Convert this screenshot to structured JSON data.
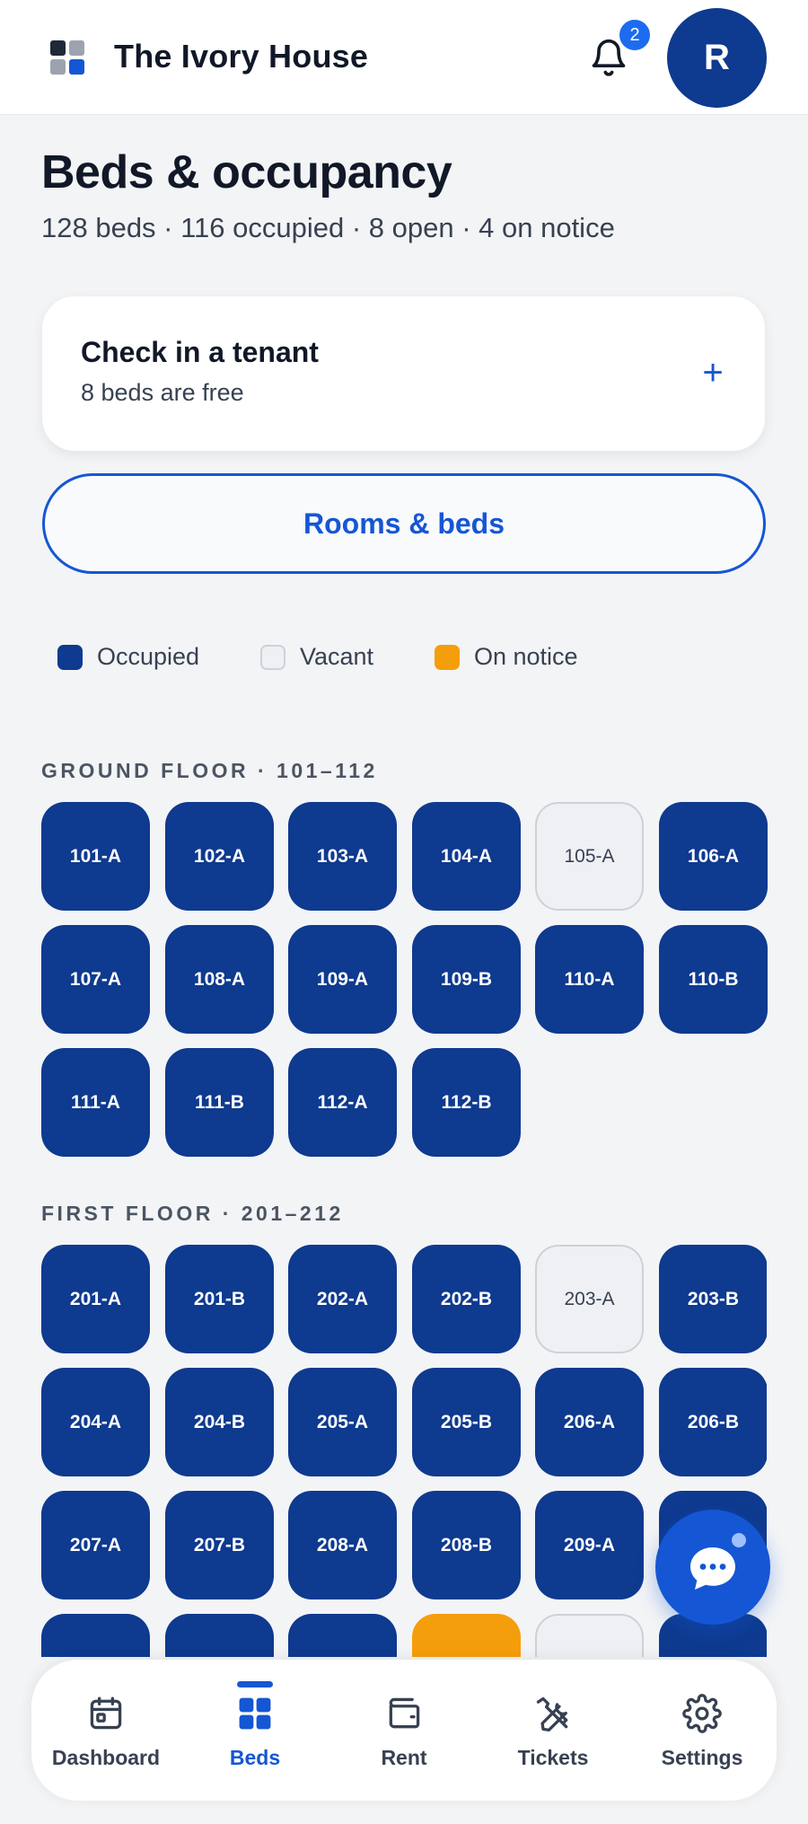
{
  "header": {
    "app_title": "The Ivory House",
    "notification_count": "2",
    "avatar_initial": "R",
    "logo_colors": [
      "#1f2937",
      "#9ca3af",
      "#9ca3af",
      "#1556d4"
    ]
  },
  "page": {
    "title": "Beds & occupancy",
    "subtitle": "128 beds · 116 occupied · 8 open · 4 on notice"
  },
  "checkin_card": {
    "title": "Check in a tenant",
    "subtitle": "8 beds are free",
    "action_icon": "plus-icon",
    "action_glyph": "+"
  },
  "rooms_button": {
    "label": "Rooms & beds"
  },
  "legend": [
    {
      "label": "Occupied",
      "status": "occupied",
      "color": "#0e3a8f"
    },
    {
      "label": "Vacant",
      "status": "vacant",
      "color": "#eef0f4"
    },
    {
      "label": "On notice",
      "status": "notice",
      "color": "#f59e0b"
    }
  ],
  "floors": [
    {
      "label": "GROUND FLOOR · 101–112",
      "beds": [
        {
          "id": "101-A",
          "status": "occupied"
        },
        {
          "id": "102-A",
          "status": "occupied"
        },
        {
          "id": "103-A",
          "status": "occupied"
        },
        {
          "id": "104-A",
          "status": "occupied"
        },
        {
          "id": "105-A",
          "status": "vacant"
        },
        {
          "id": "106-A",
          "status": "occupied"
        },
        {
          "id": "107-A",
          "status": "occupied"
        },
        {
          "id": "108-A",
          "status": "occupied"
        },
        {
          "id": "109-A",
          "status": "occupied"
        },
        {
          "id": "109-B",
          "status": "occupied"
        },
        {
          "id": "110-A",
          "status": "occupied"
        },
        {
          "id": "110-B",
          "status": "occupied"
        },
        {
          "id": "111-A",
          "status": "occupied"
        },
        {
          "id": "111-B",
          "status": "occupied"
        },
        {
          "id": "112-A",
          "status": "occupied"
        },
        {
          "id": "112-B",
          "status": "occupied"
        }
      ]
    },
    {
      "label": "FIRST FLOOR · 201–212",
      "beds": [
        {
          "id": "201-A",
          "status": "occupied"
        },
        {
          "id": "201-B",
          "status": "occupied"
        },
        {
          "id": "202-A",
          "status": "occupied"
        },
        {
          "id": "202-B",
          "status": "occupied"
        },
        {
          "id": "203-A",
          "status": "vacant"
        },
        {
          "id": "203-B",
          "status": "occupied"
        },
        {
          "id": "204-A",
          "status": "occupied"
        },
        {
          "id": "204-B",
          "status": "occupied"
        },
        {
          "id": "205-A",
          "status": "occupied"
        },
        {
          "id": "205-B",
          "status": "occupied"
        },
        {
          "id": "206-A",
          "status": "occupied"
        },
        {
          "id": "206-B",
          "status": "occupied"
        },
        {
          "id": "207-A",
          "status": "occupied"
        },
        {
          "id": "207-B",
          "status": "occupied"
        },
        {
          "id": "208-A",
          "status": "occupied"
        },
        {
          "id": "208-B",
          "status": "occupied"
        },
        {
          "id": "209-A",
          "status": "occupied"
        },
        {
          "id": "",
          "status": "occupied"
        },
        {
          "id": "",
          "status": "occupied"
        },
        {
          "id": "",
          "status": "occupied"
        },
        {
          "id": "",
          "status": "occupied"
        },
        {
          "id": "",
          "status": "notice"
        },
        {
          "id": "",
          "status": "vacant"
        },
        {
          "id": "",
          "status": "occupied"
        }
      ]
    }
  ],
  "chat": {
    "icon": "chat-bubble-icon"
  },
  "bottom_nav": [
    {
      "label": "Dashboard",
      "icon": "calendar-icon",
      "active": false
    },
    {
      "label": "Beds",
      "icon": "grid-icon",
      "active": true
    },
    {
      "label": "Rent",
      "icon": "wallet-icon",
      "active": false
    },
    {
      "label": "Tickets",
      "icon": "tools-icon",
      "active": false
    },
    {
      "label": "Settings",
      "icon": "gear-icon",
      "active": false
    }
  ],
  "colors": {
    "accent": "#1556d4",
    "occupied": "#0e3a8f",
    "vacant": "#eef0f4",
    "notice": "#f59e0b"
  }
}
